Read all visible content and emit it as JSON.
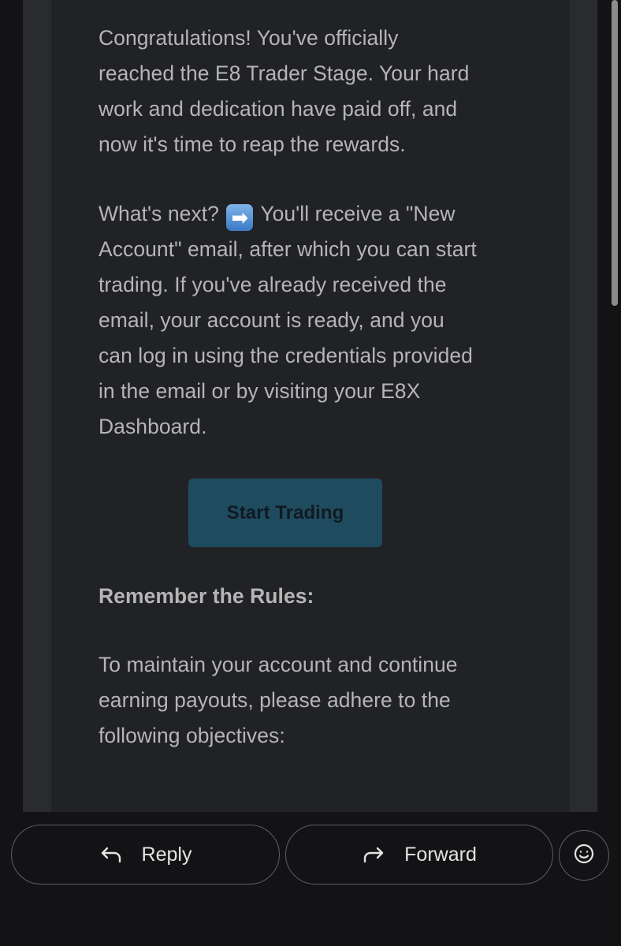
{
  "email": {
    "paragraph1": "Congratulations! You've officially reached the E8 Trader Stage. Your hard work and dedication have paid off, and now it's time to reap the rewards.",
    "paragraph2_before_emoji": "What's next?",
    "paragraph2_emoji": "➡",
    "paragraph2_after_emoji": "You'll receive a \"New Account\" email, after which you can start trading. If you've already received the email, your account is ready, and you can log in using the credentials provided in the email or by visiting your E8X Dashboard.",
    "cta_label": "Start Trading",
    "rules_heading": "Remember the Rules:",
    "paragraph3": "To maintain your account and continue earning payouts, please adhere to the following objectives:"
  },
  "actions": {
    "reply_label": "Reply",
    "forward_label": "Forward",
    "reply_icon": "reply-arrow-icon",
    "forward_icon": "forward-arrow-icon",
    "emoji_icon": "smiley-face-icon"
  },
  "colors": {
    "page_background": "#131315",
    "email_background": "#212226",
    "text": "#b5b5b5",
    "cta_background": "#1f4b5f",
    "cta_text": "#101a22",
    "action_text": "#e3e3e3"
  }
}
